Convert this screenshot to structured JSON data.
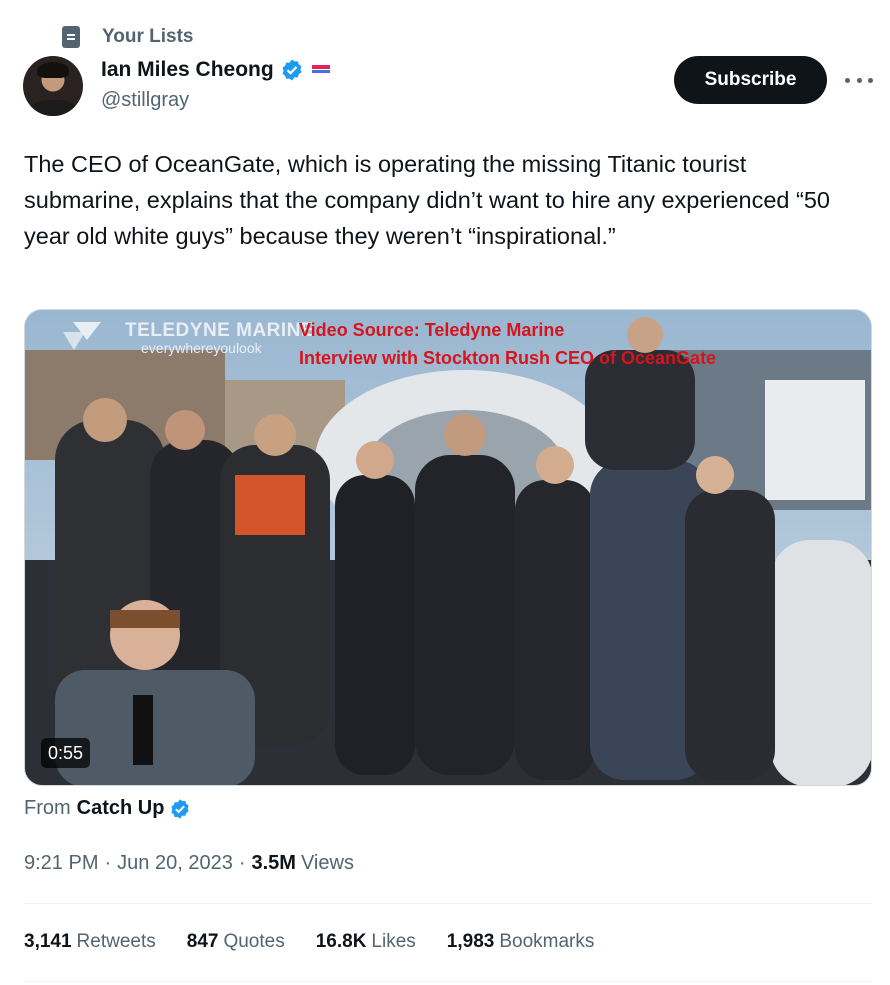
{
  "context": {
    "label": "Your Lists",
    "icon": "list-icon"
  },
  "author": {
    "name": "Ian Miles Cheong",
    "handle": "@stillgray",
    "verified_color": "#1d9bf0"
  },
  "actions": {
    "subscribe_label": "Subscribe",
    "more_icon": "more-icon"
  },
  "tweet": {
    "text": "The CEO of OceanGate, which is operating the missing Titanic tourist submarine, explains that the company didn’t want to hire any experienced “50 year old white guys” because they weren’t “inspirational.”"
  },
  "media": {
    "watermark_brand": "TELEDYNE MARINE",
    "watermark_tagline": "everywhereyoulook",
    "overlay_line1": "Video Source: Teledyne Marine",
    "overlay_line2": "Interview with Stockton Rush CEO of OceanGate",
    "duration": "0:55"
  },
  "source": {
    "prefix": "From",
    "name": "Catch Up"
  },
  "meta": {
    "time": "9:21 PM",
    "date": "Jun 20, 2023",
    "views_count": "3.5M",
    "views_label": "Views"
  },
  "stats": {
    "retweets": {
      "count": "3,141",
      "label": "Retweets"
    },
    "quotes": {
      "count": "847",
      "label": "Quotes"
    },
    "likes": {
      "count": "16.8K",
      "label": "Likes"
    },
    "bookmarks": {
      "count": "1,983",
      "label": "Bookmarks"
    }
  },
  "colors": {
    "text": "#0f1419",
    "secondary": "#536471",
    "accent": "#1d9bf0",
    "overlay_red": "#d6141b"
  }
}
